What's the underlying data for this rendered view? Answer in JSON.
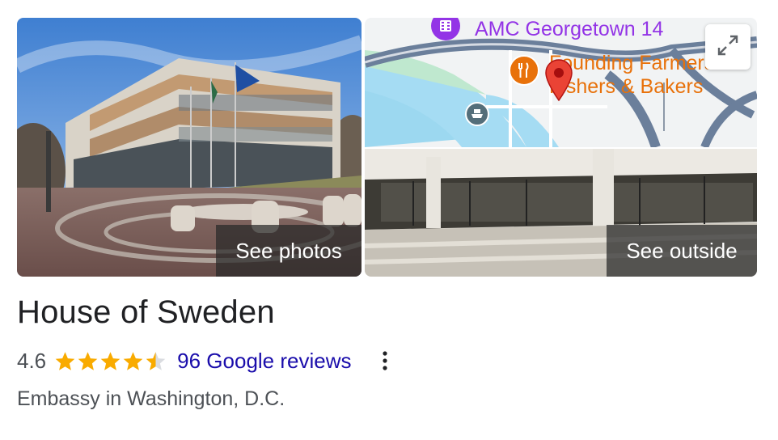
{
  "place": {
    "name": "House of Sweden",
    "rating": "4.6",
    "reviews_label": "96 Google reviews",
    "category": "Embassy in Washington, D.C.",
    "stars_filled": 4.5
  },
  "media": {
    "photos_button": "See photos",
    "outside_button": "See outside"
  },
  "map": {
    "poi_cinema": "AMC Georgetown 14",
    "poi_restaurant_line1": "Founding Farmers",
    "poi_restaurant_line2": "Fishers & Bakers",
    "icons": [
      "film-icon",
      "restaurant-icon",
      "location-pin-icon",
      "ferry-icon",
      "expand-icon"
    ]
  },
  "colors": {
    "star": "#f9ab00",
    "link": "#1a0dab",
    "cinema_poi": "#9334e6",
    "restaurant_poi": "#e8710a",
    "pin": "#ea4335"
  }
}
